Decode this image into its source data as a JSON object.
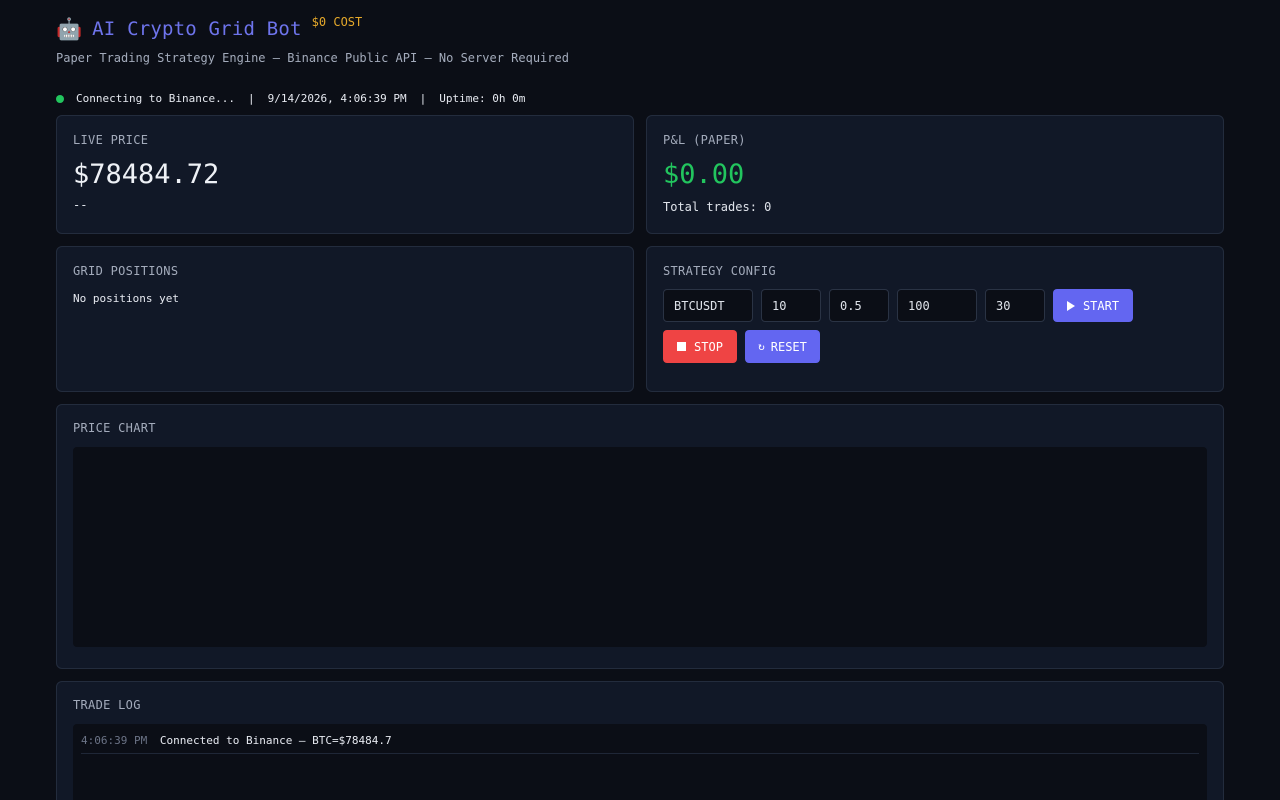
{
  "header": {
    "icon": "robot-icon",
    "icon_glyph": "🤖",
    "title": "AI Crypto Grid Bot",
    "badge": "$0 COST",
    "subtitle": "Paper Trading Strategy Engine — Binance Public API — No Server Required"
  },
  "status": {
    "connection": "Connecting to Binance...",
    "separator": "|",
    "datetime": "9/14/2026, 4:06:39 PM",
    "uptime": "Uptime: 0h 0m",
    "dot_color": "#22c55e"
  },
  "live_price": {
    "title": "LIVE PRICE",
    "value": "$78484.72",
    "change": "--"
  },
  "pnl": {
    "title": "P&L (PAPER)",
    "value": "$0.00",
    "trades": "Total trades: 0",
    "value_color": "#22c55e"
  },
  "grid_positions": {
    "title": "GRID POSITIONS",
    "empty_text": "No positions yet"
  },
  "strategy": {
    "title": "STRATEGY CONFIG",
    "inputs": {
      "symbol": "BTCUSDT",
      "grids": "10",
      "spacing": "0.5",
      "investment": "100",
      "interval": "30"
    },
    "start_label": "START",
    "stop_label": "STOP",
    "reset_label": "RESET",
    "reset_glyph": "↻"
  },
  "price_chart": {
    "title": "PRICE CHART"
  },
  "trade_log": {
    "title": "TRADE LOG",
    "entries": [
      {
        "time": "4:06:39 PM",
        "message": "Connected to Binance — BTC=$78484.7"
      }
    ]
  },
  "colors": {
    "accent": "#6366f1",
    "danger": "#ef4444",
    "success": "#22c55e",
    "badge": "#e5a82a",
    "background": "#0b0e16",
    "card": "#111827"
  }
}
